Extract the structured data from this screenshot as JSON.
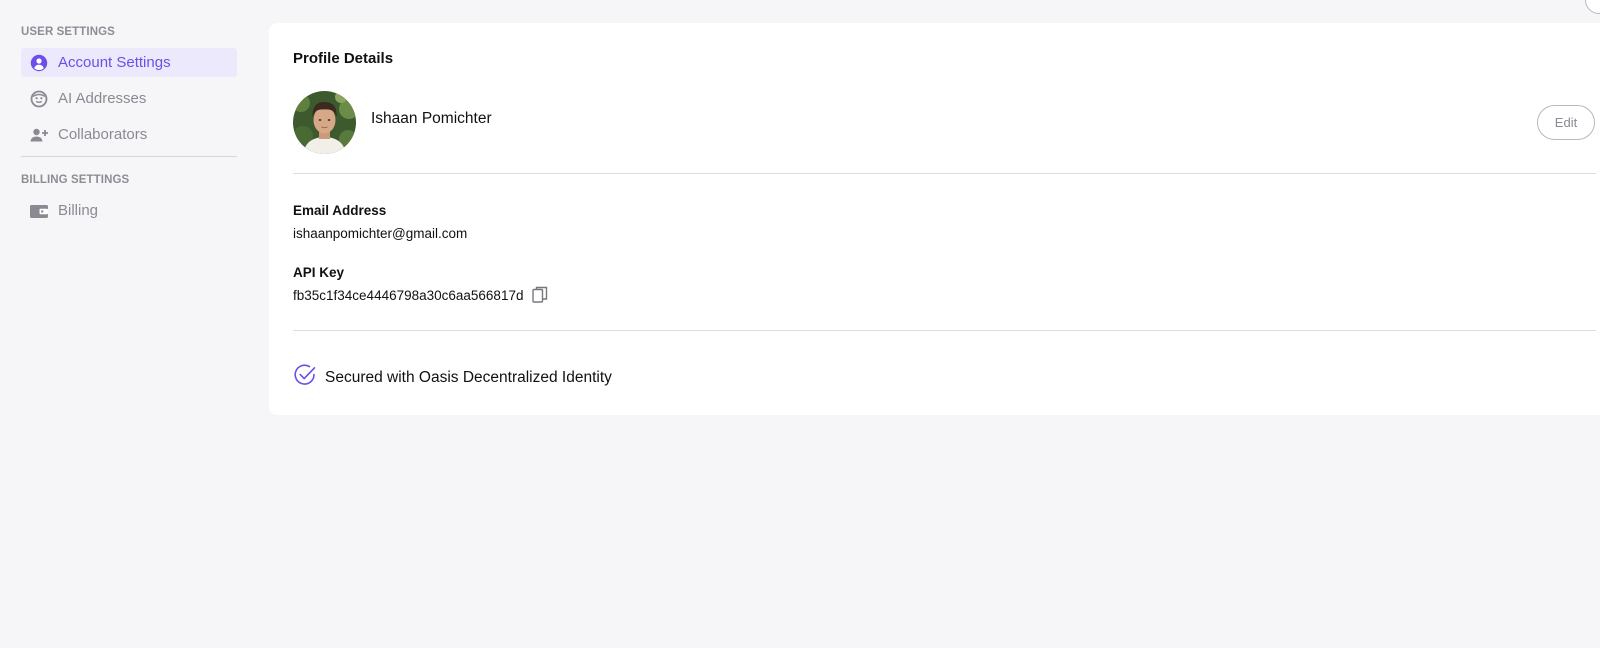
{
  "sidebar": {
    "user_settings_title": "USER SETTINGS",
    "billing_settings_title": "BILLING SETTINGS",
    "items": [
      {
        "label": "Account Settings",
        "icon": "user-circle-icon",
        "active": true
      },
      {
        "label": "AI Addresses",
        "icon": "robot-face-icon",
        "active": false
      },
      {
        "label": "Collaborators",
        "icon": "user-plus-icon",
        "active": false
      },
      {
        "label": "Billing",
        "icon": "wallet-icon",
        "active": false
      }
    ]
  },
  "profile": {
    "title": "Profile Details",
    "name": "Ishaan Pomichter",
    "edit_label": "Edit",
    "email_label": "Email Address",
    "email": "ishaanpomichter@gmail.com",
    "api_key_label": "API Key",
    "api_key": "fb35c1f34ce4446798a30c6aa566817d",
    "secured_text": "Secured with Oasis Decentralized Identity"
  },
  "colors": {
    "accent": "#6c4ee8",
    "active_bg": "#ece9fd",
    "page_bg": "#f6f6f8",
    "muted_text": "#8a8a93"
  }
}
